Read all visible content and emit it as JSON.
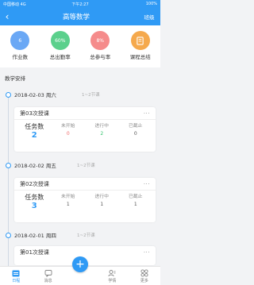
{
  "status_bar": {
    "carrier": "中国移动 4G",
    "time": "下午2:27",
    "battery": "100%"
  },
  "navbar": {
    "back_symbol": "‹",
    "title": "高等数学",
    "action": "班级"
  },
  "stats": [
    {
      "value": "6",
      "label": "作业数",
      "color": "#6aa8f5"
    },
    {
      "value": "60%",
      "label": "总出勤率",
      "color": "#5bd08c"
    },
    {
      "value": "8%",
      "label": "总参与率",
      "color": "#f58b8b"
    },
    {
      "value": "",
      "label": "课程总结",
      "color": "#f5a94d",
      "icon": "summary-icon"
    }
  ],
  "section_title": "教学安排",
  "schedule": [
    {
      "date": "2018-02-03 周六",
      "slot": "1~2节课",
      "card_title": "第03次授课",
      "more": "···",
      "task_label": "任务数",
      "task_value": "2",
      "cols": [
        {
          "label": "未开始",
          "value": "0"
        },
        {
          "label": "进行中",
          "value": "2"
        },
        {
          "label": "已截止",
          "value": "0"
        }
      ]
    },
    {
      "date": "2018-02-02 周五",
      "slot": "1~2节课",
      "card_title": "第02次授课",
      "more": "···",
      "task_label": "任务数",
      "task_value": "3",
      "cols": [
        {
          "label": "未开始",
          "value": "1"
        },
        {
          "label": "进行中",
          "value": "1"
        },
        {
          "label": "已截止",
          "value": "1"
        }
      ]
    },
    {
      "date": "2018-02-01 周四",
      "slot": "1~2节课",
      "card_title": "第01次授课",
      "more": "···"
    }
  ],
  "tabs": [
    {
      "label": "日程",
      "icon": "calendar-icon",
      "active": true
    },
    {
      "label": "消息",
      "icon": "message-icon"
    },
    {
      "label": "",
      "icon": "add-icon"
    },
    {
      "label": "学情",
      "icon": "learning-icon"
    },
    {
      "label": "更多",
      "icon": "grid-icon"
    }
  ],
  "colors": {
    "primary": "#2f9af5",
    "red": "#f06a6a",
    "green": "#2fc36a"
  }
}
